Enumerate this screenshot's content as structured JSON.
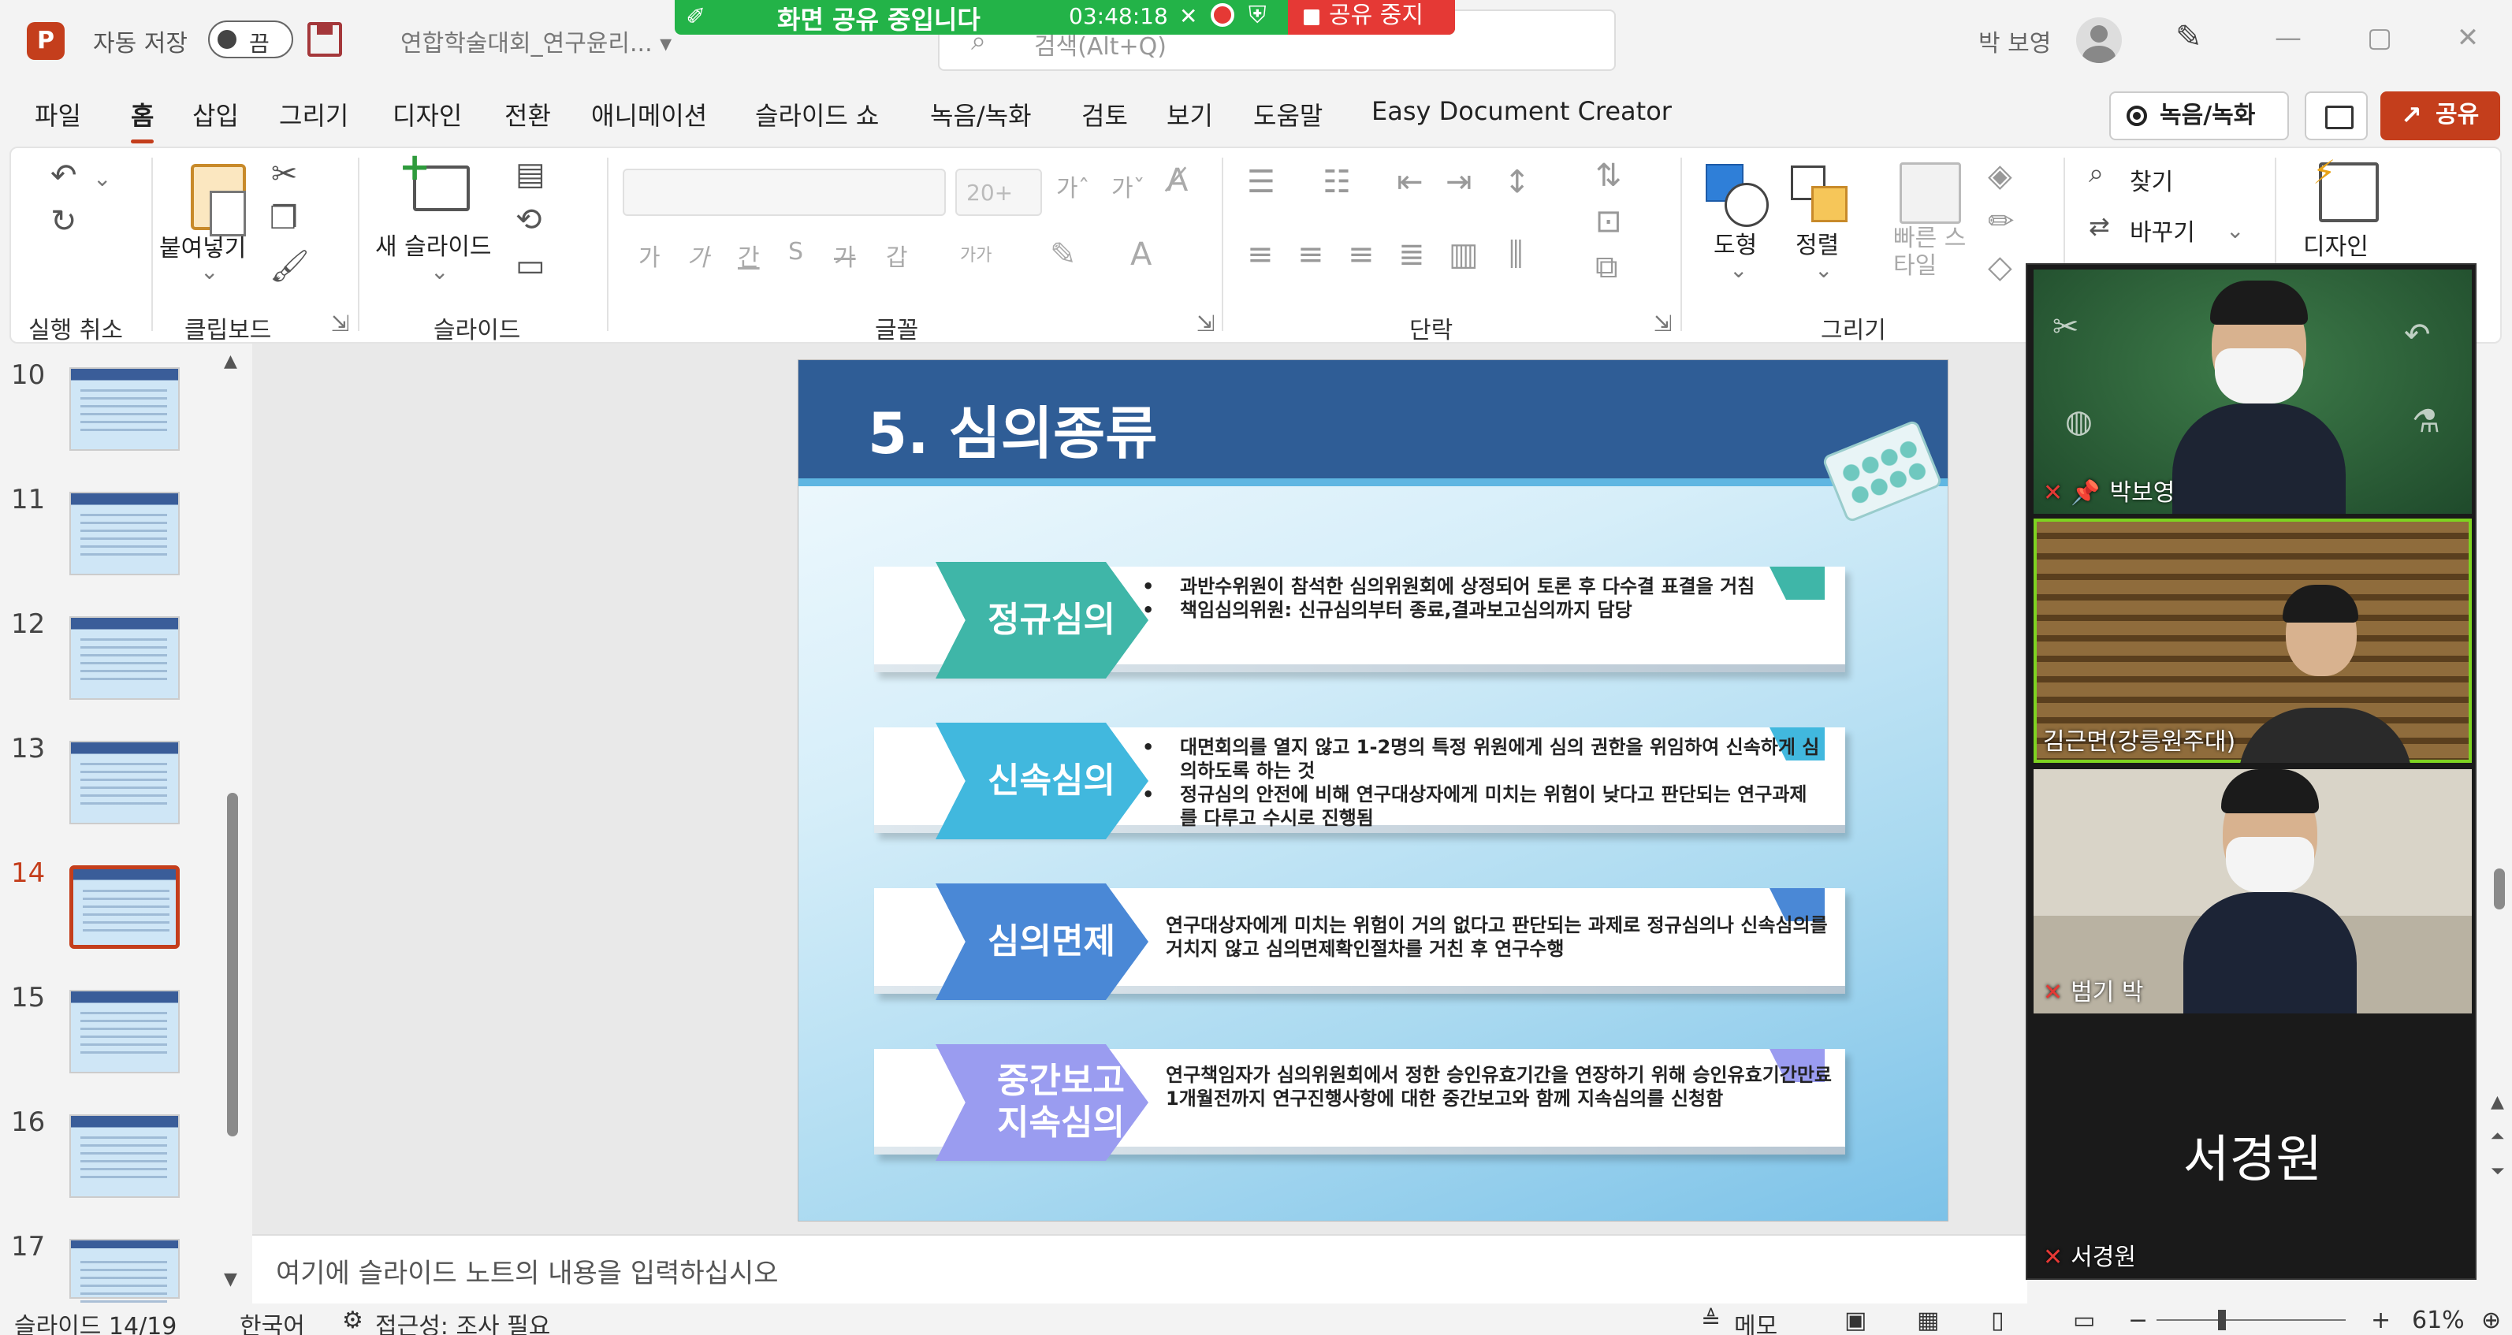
{
  "titlebar": {
    "app_logo": "P",
    "autosave_label": "자동 저장",
    "autosave_state": "끔",
    "doc_title": "연합학술대회_연구윤리... ▾",
    "search_placeholder": "검색(Alt+Q)",
    "user_name": "박 보영",
    "win_min": "—",
    "win_max": "▢",
    "win_close": "✕"
  },
  "share_banner": {
    "label": "화면 공유 중입니다",
    "timer": "03:48:18",
    "stop_label": "공유 중지",
    "accent": "#23b348",
    "stop_color": "#e53935"
  },
  "menu": {
    "tabs": [
      "파일",
      "홈",
      "삽입",
      "그리기",
      "디자인",
      "전환",
      "애니메이션",
      "슬라이드 쇼",
      "녹음/녹화",
      "검토",
      "보기",
      "도움말",
      "Easy Document Creator"
    ],
    "active_tab": "홈",
    "record_button": "녹음/녹화",
    "share_button": "공유"
  },
  "ribbon": {
    "groups": {
      "undo": "실행 취소",
      "clipboard": "클립보드",
      "slides": "슬라이드",
      "font": "글꼴",
      "paragraph": "단락",
      "drawing": "그리기"
    },
    "paste": "붙여넣기",
    "new_slide": "새 슬라이드",
    "font_size": "20+",
    "shape": "도형",
    "arrange": "정렬",
    "quick_style": "빠른 스타일",
    "find": "찾기",
    "replace": "바꾸기",
    "designer": "디자인",
    "font_buttons": [
      "가",
      "가",
      "간",
      "S",
      "가",
      "갑",
      "가가"
    ],
    "grow_font": "가ˆ",
    "shrink_font": "가ˇ"
  },
  "thumbnails": {
    "items": [
      {
        "num": "10"
      },
      {
        "num": "11"
      },
      {
        "num": "12"
      },
      {
        "num": "13"
      },
      {
        "num": "14"
      },
      {
        "num": "15"
      },
      {
        "num": "16"
      },
      {
        "num": "17"
      }
    ],
    "active": "14"
  },
  "slide": {
    "title": "5. 심의종류",
    "rows": [
      {
        "badge": "정규심의",
        "color": "#3fb6a8",
        "bullets": [
          "과반수위원이 참석한 심의위원회에 상정되어 토론 후 다수결 표결을 거침",
          "책임심의위원: 신규심의부터 종료,결과보고심의까지 담당"
        ]
      },
      {
        "badge": "신속심의",
        "color": "#41b8de",
        "bullets": [
          "대면회의를 열지 않고 1-2명의 특정 위원에게 심의 권한을 위임하여 신속하게 심의하도록 하는 것",
          "정규심의 안전에 비해 연구대상자에게 미치는 위험이 낮다고 판단되는 연구과제를 다루고 수시로 진행됨"
        ]
      },
      {
        "badge": "심의면제",
        "color": "#4a88d6",
        "text": "연구대상자에게 미치는 위험이 거의 없다고 판단되는 과제로 정규심의나 신속심의를 거치지 않고 심의면제확인절차를 거친 후 연구수행"
      },
      {
        "badge_line1": "중간보고",
        "badge_line2": "지속심의",
        "color": "#9a9cf0",
        "text": "연구책임자가 심의위원회에서 정한 승인유효기간을 연장하기 위해 승인유효기간만료 1개월전까지 연구진행사항에 대한 중간보고와 함께 지속심의를 신청함"
      }
    ]
  },
  "notes": {
    "placeholder": "여기에 슬라이드 노트의 내용을 입력하십시오"
  },
  "video_call": {
    "participants": [
      {
        "name": "박보영"
      },
      {
        "name": "김근면(강릉원주대)"
      },
      {
        "name": "범기 박"
      },
      {
        "name": "서경원",
        "display": "서경원"
      }
    ]
  },
  "statusbar": {
    "slide_pos": "슬라이드 14/19",
    "language": "한국어",
    "accessibility": "접근성: 조사 필요",
    "notes": "메모",
    "zoom_minus": "−",
    "zoom_plus": "+",
    "zoom": "61%"
  }
}
